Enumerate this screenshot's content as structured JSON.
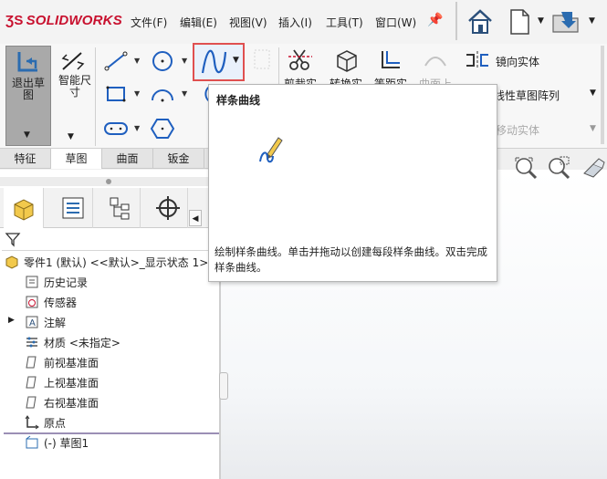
{
  "app": {
    "logo_text": "SOLIDWORKS"
  },
  "menu": [
    "文件(F)",
    "编辑(E)",
    "视图(V)",
    "插入(I)",
    "工具(T)",
    "窗口(W)"
  ],
  "ribbon": {
    "exit_sketch": "退出草\n图",
    "smart_dimension": "智能尺\n寸",
    "trim": "剪裁实",
    "convert": "转换实",
    "offset": "等距实",
    "surface_on": "曲面上",
    "mirror": "镜向实体",
    "linear_pattern": "线性草图阵列",
    "move": "移动实体"
  },
  "command_tabs": [
    "特征",
    "草图",
    "曲面",
    "钣金"
  ],
  "active_command_tab": "草图",
  "tooltip": {
    "title": "样条曲线",
    "description": "绘制样条曲线。单击并拖动以创建每段样条曲线。双击完成样条曲线。"
  },
  "feature_tree": {
    "root": "零件1 (默认) <<默认>_显示状态 1>",
    "items": [
      {
        "label": "历史记录",
        "icon": "history-icon"
      },
      {
        "label": "传感器",
        "icon": "sensor-icon"
      },
      {
        "label": "注解",
        "icon": "annotation-icon"
      },
      {
        "label": "材质 <未指定>",
        "icon": "material-icon"
      },
      {
        "label": "前视基准面",
        "icon": "plane-icon"
      },
      {
        "label": "上视基准面",
        "icon": "plane-icon"
      },
      {
        "label": "右视基准面",
        "icon": "plane-icon"
      },
      {
        "label": "原点",
        "icon": "origin-icon"
      },
      {
        "label": "(-) 草图1",
        "icon": "sketch-icon"
      }
    ]
  },
  "colors": {
    "brand": "#c8102e",
    "highlight": "#e05050",
    "accent": "#1f5fbf"
  }
}
